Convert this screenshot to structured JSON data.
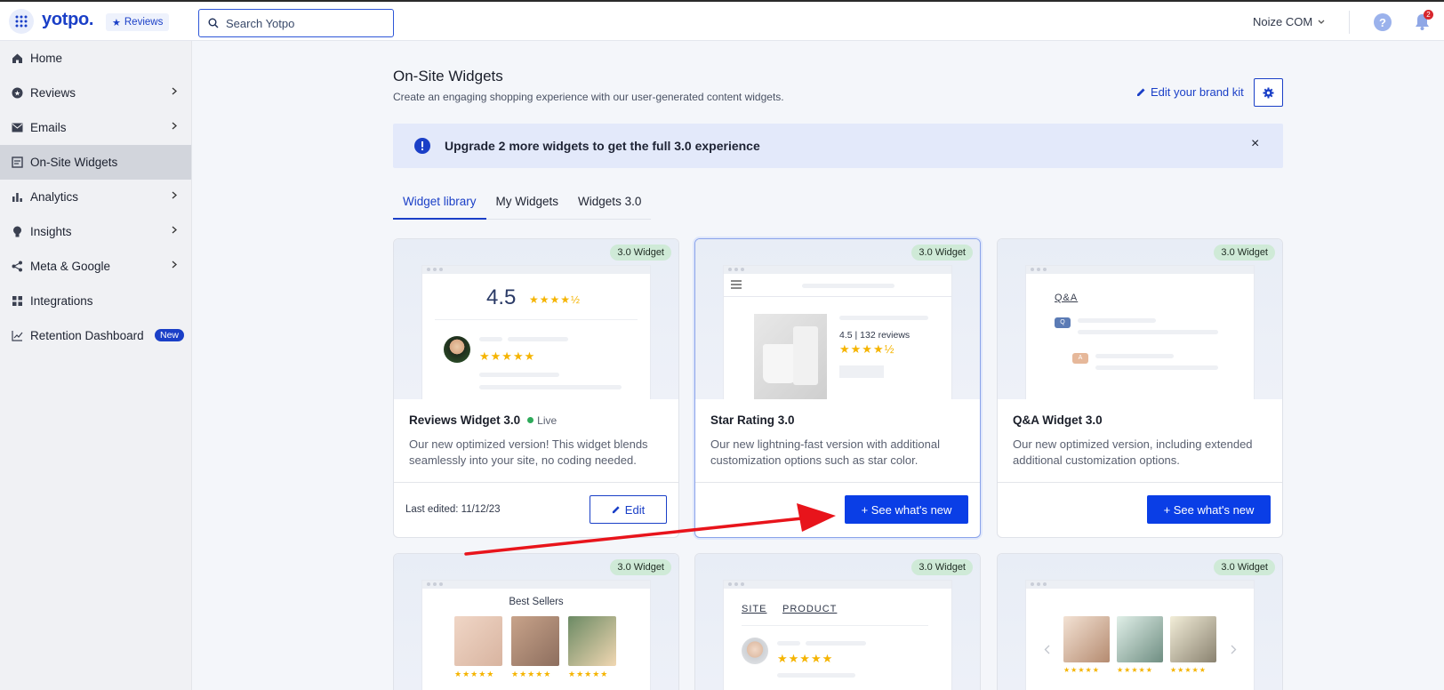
{
  "topbar": {
    "logo": "yotpo.",
    "product_chip": "Reviews",
    "search_placeholder": "Search Yotpo",
    "account_name": "Noize COM",
    "notification_count": "2"
  },
  "sidebar": {
    "items": [
      {
        "label": "Home",
        "icon": "home-icon",
        "chevron": false
      },
      {
        "label": "Reviews",
        "icon": "star-circle-icon",
        "chevron": true
      },
      {
        "label": "Emails",
        "icon": "mail-icon",
        "chevron": true
      },
      {
        "label": "On-Site Widgets",
        "icon": "widget-icon",
        "chevron": false,
        "active": true
      },
      {
        "label": "Analytics",
        "icon": "bar-chart-icon",
        "chevron": true
      },
      {
        "label": "Insights",
        "icon": "lightbulb-icon",
        "chevron": true
      },
      {
        "label": "Meta & Google",
        "icon": "share-icon",
        "chevron": true
      },
      {
        "label": "Integrations",
        "icon": "grid-plus-icon",
        "chevron": false
      },
      {
        "label": "Retention Dashboard",
        "icon": "line-chart-icon",
        "chevron": false,
        "badge": "New"
      }
    ]
  },
  "header": {
    "title": "On-Site Widgets",
    "subtitle": "Create an engaging shopping experience with our user-generated content widgets.",
    "brand_kit_link": "Edit your brand kit"
  },
  "banner": {
    "text": "Upgrade 2 more widgets to get the full 3.0 experience",
    "close": "×"
  },
  "tabs": [
    "Widget library",
    "My Widgets",
    "Widgets 3.0"
  ],
  "cards": [
    {
      "badge": "3.0 Widget",
      "title": "Reviews Widget 3.0",
      "status": "Live",
      "description": "Our new optimized version! This widget blends seamlessly into your site, no coding needed.",
      "last_edited": "Last edited: 11/12/23",
      "action": "Edit",
      "preview_rating": "4.5",
      "preview_stars": "★★★★½",
      "preview_review_stars": "★★★★★"
    },
    {
      "badge": "3.0 Widget",
      "title": "Star Rating 3.0",
      "description": "Our new lightning-fast version with additional customization options such as star color.",
      "action": "+ See what's new",
      "preview_text": "4.5 | 132 reviews",
      "preview_stars": "★★★★½"
    },
    {
      "badge": "3.0 Widget",
      "title": "Q&A Widget 3.0",
      "description": "Our new optimized version, including extended additional customization options.",
      "action": "+ See what's new",
      "preview_heading": "Q&A",
      "preview_q": "Q",
      "preview_a": "A"
    },
    {
      "badge": "3.0 Widget",
      "preview_heading": "Best Sellers",
      "preview_stars": "★★★★★"
    },
    {
      "badge": "3.0 Widget",
      "preview_tab1": "SITE",
      "preview_tab2": "PRODUCT",
      "preview_stars": "★★★★★"
    },
    {
      "badge": "3.0 Widget",
      "preview_stars": "★★★★★"
    }
  ],
  "colors": {
    "brand_blue": "#1a3fc7",
    "primary_button": "#0a3ee6",
    "badge_green": "#cfead7",
    "star_gold": "#f5b400",
    "annotation_arrow": "#e8141b"
  }
}
